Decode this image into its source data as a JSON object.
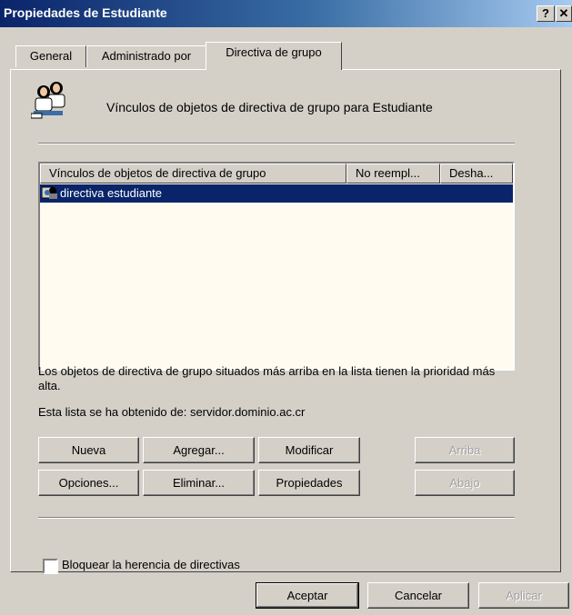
{
  "window": {
    "title": "Propiedades de Estudiante",
    "help_label": "?",
    "close_label": "✕"
  },
  "tabs": [
    {
      "label": "General"
    },
    {
      "label": "Administrado por"
    },
    {
      "label": "Directiva de grupo",
      "active": true
    }
  ],
  "header": {
    "icon": "users-group-icon",
    "text": "Vínculos de objetos de directiva de grupo para Estudiante"
  },
  "list": {
    "columns": [
      "Vínculos de objetos de directiva de grupo",
      "No reempl...",
      "Desha..."
    ],
    "rows": [
      {
        "icon": "gpo-icon",
        "name": "directiva estudiante",
        "no_override": "",
        "disabled": "",
        "selected": true
      }
    ]
  },
  "info": {
    "priority_note": "Los objetos de directiva de grupo situados más arriba en la lista tienen la prioridad más alta.",
    "source": "Esta lista se ha obtenido de: servidor.dominio.ac.cr"
  },
  "buttons": {
    "new": "Nueva",
    "add": "Agregar...",
    "edit": "Modificar",
    "up": "Arriba",
    "options": "Opciones...",
    "delete": "Eliminar...",
    "properties": "Propiedades",
    "down": "Abajo"
  },
  "block_inheritance": {
    "label": "Bloquear la herencia de directivas",
    "checked": false
  },
  "footer": {
    "ok": "Aceptar",
    "cancel": "Cancelar",
    "apply": "Aplicar"
  },
  "colors": {
    "title_bar": "#0a246a",
    "selection": "#0a246a",
    "face": "#d4d0c8",
    "list_bg": "#fffbf0"
  }
}
